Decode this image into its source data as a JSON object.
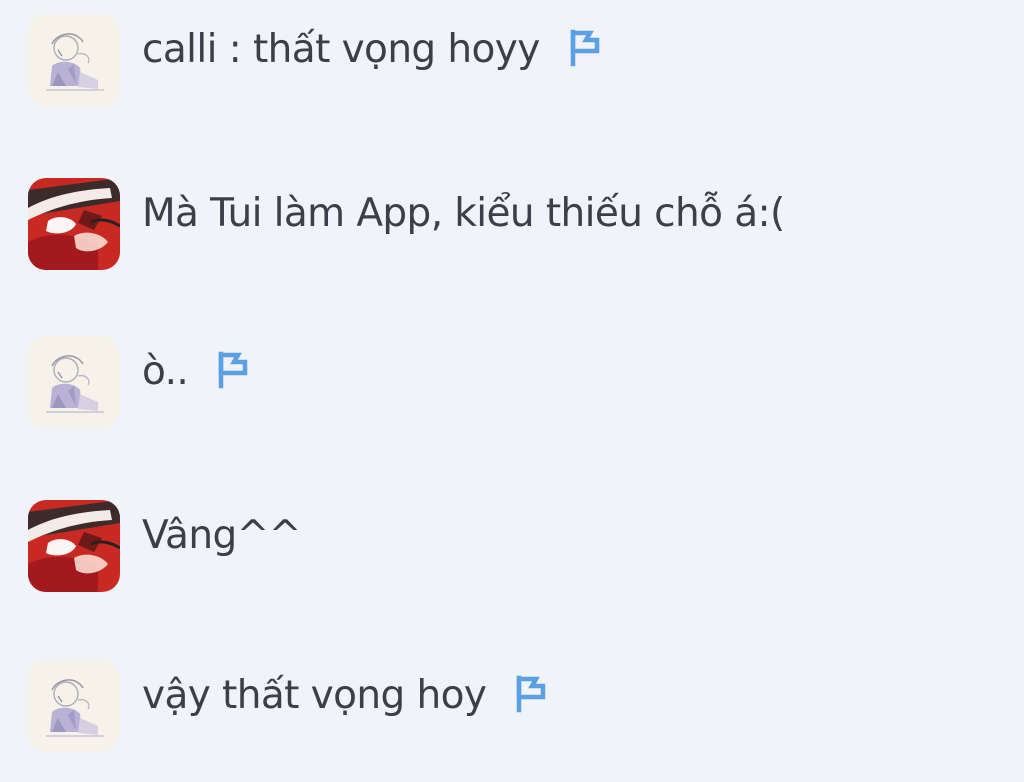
{
  "colors": {
    "background": "#f0f3f8",
    "text": "#3b3f47",
    "flag": "#5aa0e2",
    "sketch_avatar_bg": "#f6f2ea",
    "red_avatar": "#c82a23"
  },
  "messages": [
    {
      "text": "calli : thất vọng hoyy",
      "avatar": "sketch",
      "flag_icon": "flag-icon"
    },
    {
      "text": "Mà Tui làm App, kiểu thiếu chỗ á:(",
      "avatar": "red"
    },
    {
      "text": "ò..",
      "avatar": "sketch",
      "flag_icon": "flag-icon"
    },
    {
      "text": "Vâng^^",
      "avatar": "red"
    },
    {
      "text": "vậy thất vọng hoy",
      "avatar": "sketch",
      "flag_icon": "flag-icon"
    }
  ]
}
